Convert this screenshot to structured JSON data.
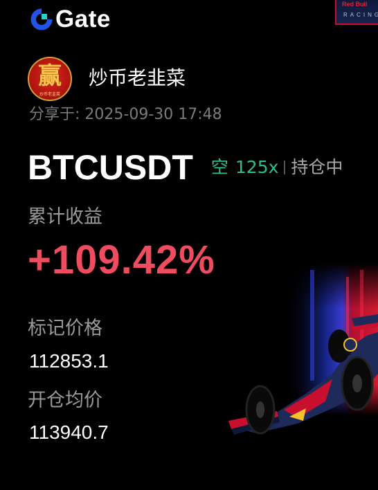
{
  "brand": {
    "name": "Gate",
    "logo_icon": "gate-logo-icon"
  },
  "sponsor_badge": {
    "brand": "Red Bull",
    "subtitle": "RACING"
  },
  "user": {
    "avatar_char": "赢",
    "avatar_caption": "炒币老韭菜",
    "name": "炒币老韭菜"
  },
  "share": {
    "label": "分享于:",
    "datetime": "2025-09-30 17:48"
  },
  "position": {
    "symbol": "BTCUSDT",
    "side": "空",
    "leverage": "125x",
    "status": "持仓中"
  },
  "pnl": {
    "label": "累计收益",
    "value": "+109.42%"
  },
  "mark_price": {
    "label": "标记价格",
    "value": "112853.1"
  },
  "entry_price": {
    "label": "开仓均价",
    "value": "113940.7"
  },
  "colors": {
    "background": "#000000",
    "short_green": "#2fbf8a",
    "profit_red": "#ef4c5f",
    "label_gray": "#9a9a9a",
    "muted_gray": "#7b7b7b",
    "brand_blue": "#2354e6"
  }
}
